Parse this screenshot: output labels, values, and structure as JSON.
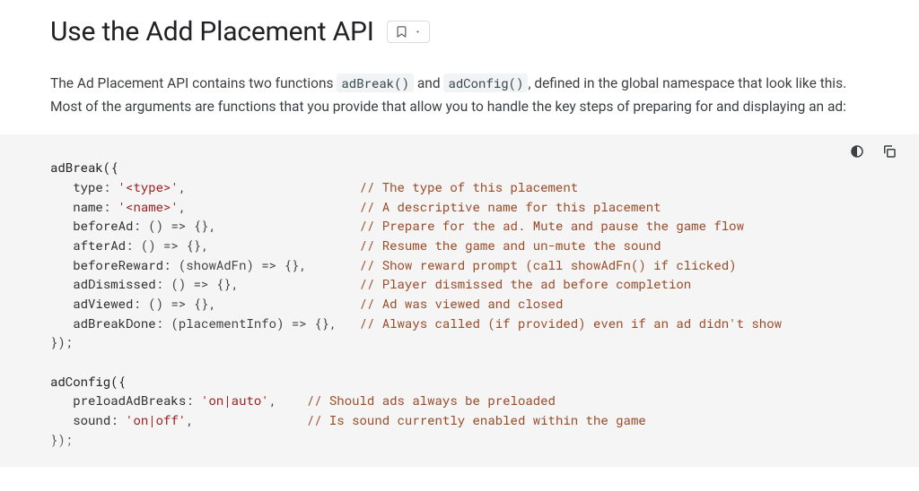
{
  "heading": "Use the Add Placement API",
  "intro": {
    "pre": "The Ad Placement API contains two functions ",
    "fn1": "adBreak()",
    "mid": " and ",
    "fn2": "adConfig()",
    "post": ", defined in the global namespace that look like this. Most of the arguments are functions that you provide that allow you to handle the key steps of preparing for and displaying an ad:"
  },
  "code": {
    "block1": {
      "open": "adBreak({",
      "lines": [
        {
          "key": "type",
          "val": "'<type>'",
          "sep": ",",
          "comment": "// The type of this placement"
        },
        {
          "key": "name",
          "val": "'<name>'",
          "sep": ",",
          "comment": "// A descriptive name for this placement"
        },
        {
          "key": "beforeAd",
          "val": "() => {}",
          "sep": ",",
          "comment": "// Prepare for the ad. Mute and pause the game flow"
        },
        {
          "key": "afterAd",
          "val": "() => {}",
          "sep": ",",
          "comment": "// Resume the game and un-mute the sound"
        },
        {
          "key": "beforeReward",
          "val": "(showAdFn) => {}",
          "sep": ",",
          "comment": "// Show reward prompt (call showAdFn() if clicked)"
        },
        {
          "key": "adDismissed",
          "val": "() => {}",
          "sep": ",",
          "comment": "// Player dismissed the ad before completion"
        },
        {
          "key": "adViewed",
          "val": "() => {}",
          "sep": ",",
          "comment": "// Ad was viewed and closed"
        },
        {
          "key": "adBreakDone",
          "val": "(placementInfo) => {}",
          "sep": ",",
          "comment": "// Always called (if provided) even if an ad didn't show"
        }
      ],
      "close": "});",
      "col": 41
    },
    "block2": {
      "open": "adConfig({",
      "lines": [
        {
          "key": "preloadAdBreaks",
          "val": "'on|auto'",
          "sep": ",",
          "comment": "// Should ads always be preloaded"
        },
        {
          "key": "sound",
          "val": "'on|off'",
          "sep": ",",
          "comment": "// Is sound currently enabled within the game"
        }
      ],
      "close": "});",
      "col": 34
    }
  },
  "icons": {
    "bookmark": "bookmark",
    "chevron": "chevron-down",
    "theme": "theme-toggle",
    "copy": "copy"
  }
}
